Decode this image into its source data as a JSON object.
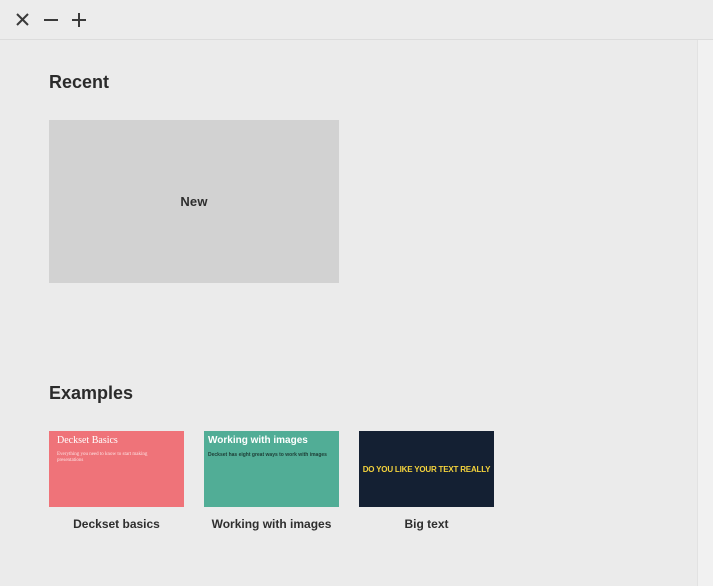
{
  "titlebar": {
    "close_icon": "close-icon",
    "minimize_icon": "minimize-icon",
    "maximize_icon": "maximize-icon"
  },
  "recent": {
    "title": "Recent",
    "new_label": "New"
  },
  "examples": {
    "title": "Examples",
    "items": [
      {
        "caption": "Deckset basics",
        "thumb_title": "Deckset Basics",
        "thumb_subtitle": "Everything you need to know to start making presentations",
        "color": "#ef7379"
      },
      {
        "caption": "Working with images",
        "thumb_title": "Working with images",
        "thumb_subtitle": "Deckset has eight great ways to work with images",
        "color": "#51ad96"
      },
      {
        "caption": "Big text",
        "thumb_title": "DO YOU LIKE YOUR TEXT REALLY",
        "color": "#142033",
        "text_color": "#f3d23c"
      }
    ]
  }
}
